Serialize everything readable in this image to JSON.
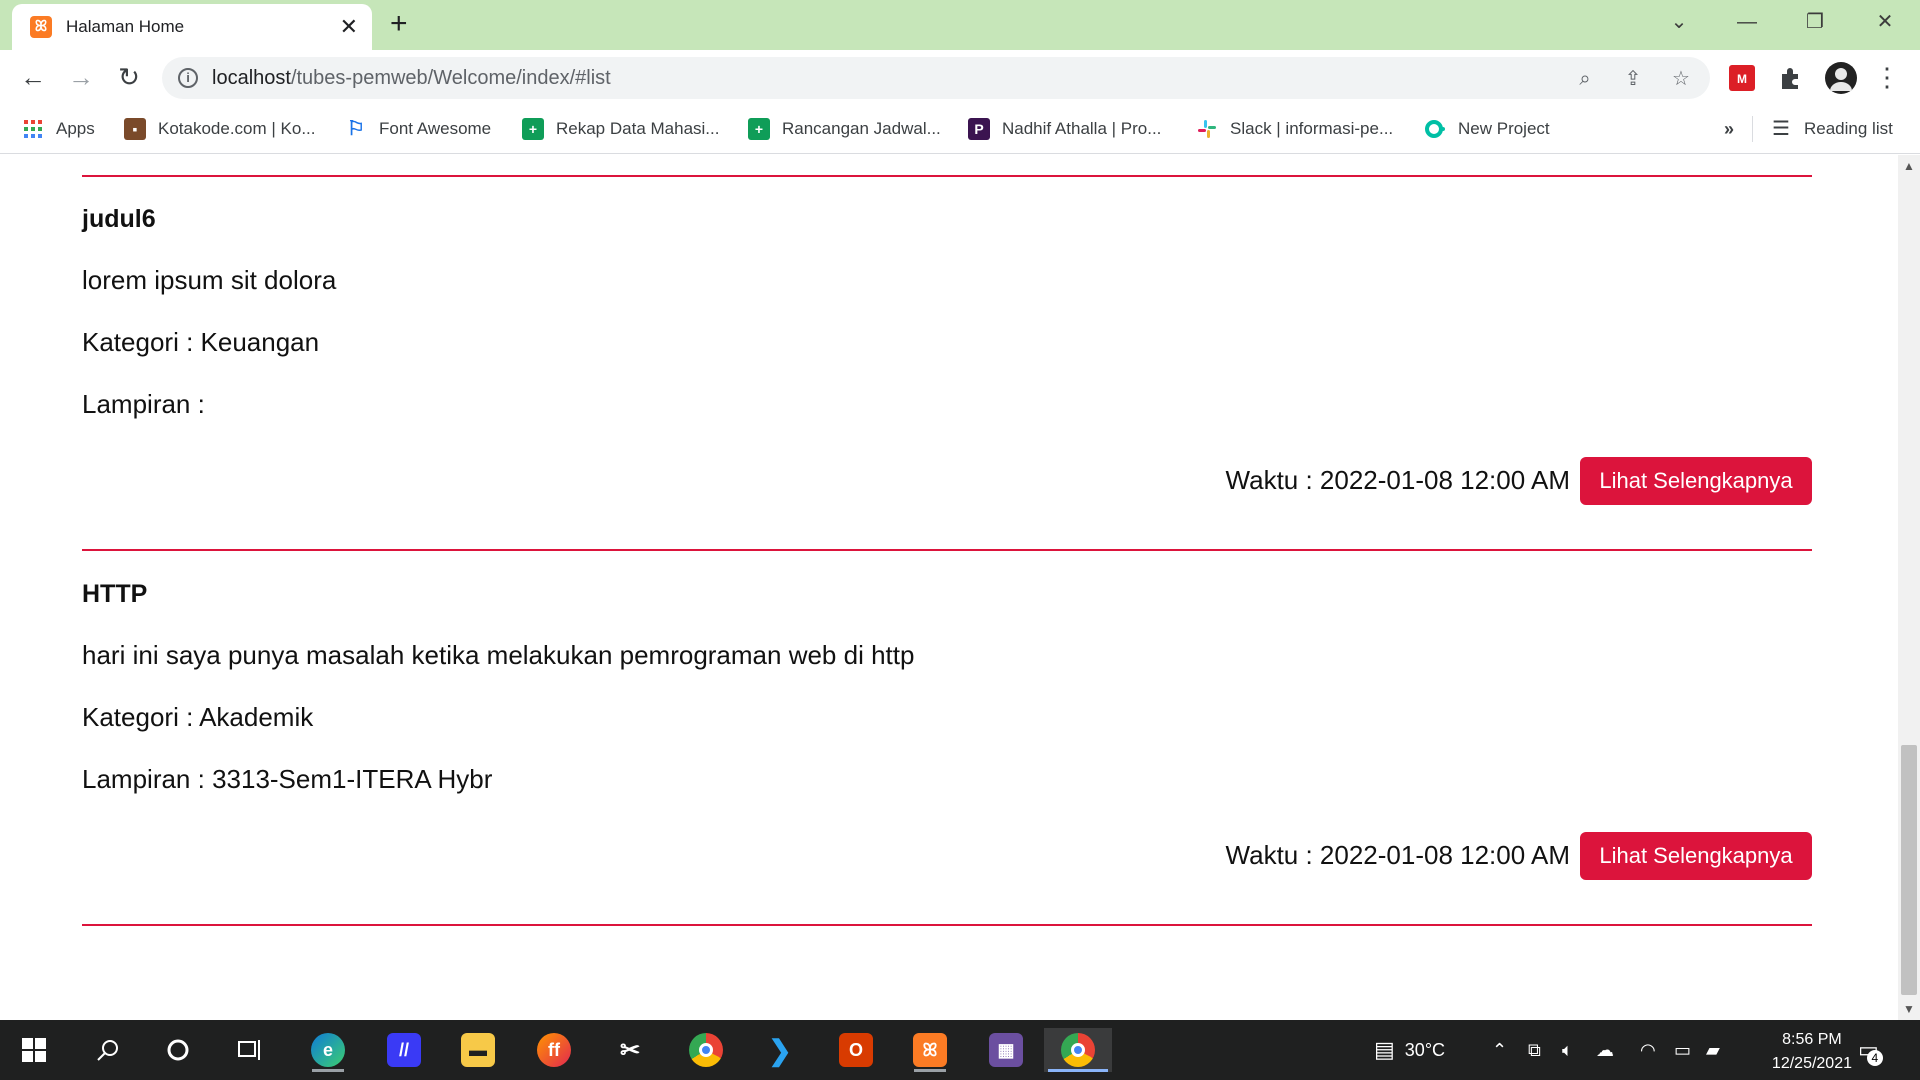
{
  "browser": {
    "tab_title": "Halaman Home",
    "url_host": "localhost",
    "url_path": "/tubes-pemweb/Welcome/index/#list",
    "bookmarks": [
      {
        "label": "Apps",
        "icon": "apps-grid-icon",
        "color": "#ea4335"
      },
      {
        "label": "Kotakode.com | Ko...",
        "icon": "kotakode-icon",
        "color": "#7a4a2a"
      },
      {
        "label": "Font Awesome",
        "icon": "flag-icon",
        "color": "#1a73e8"
      },
      {
        "label": "Rekap Data Mahasi...",
        "icon": "sheets-icon",
        "color": "#0f9d58"
      },
      {
        "label": "Rancangan Jadwal...",
        "icon": "sheets-icon",
        "color": "#0f9d58"
      },
      {
        "label": "Nadhif Athalla | Pro...",
        "icon": "p-icon",
        "color": "#3b1450"
      },
      {
        "label": "Slack | informasi-pe...",
        "icon": "slack-icon",
        "color": "#e01e5a"
      },
      {
        "label": "New Project",
        "icon": "project-icon",
        "color": "#00bfa5"
      }
    ],
    "more_bookmarks": "»",
    "reading_list": "Reading list"
  },
  "posts": [
    {
      "title": "judul6",
      "body": "lorem ipsum sit dolora",
      "category": "Kategori : Keuangan",
      "attachment": "Lampiran :",
      "time": "Waktu : 2022-01-08 12:00 AM",
      "button": "Lihat Selengkapnya"
    },
    {
      "title": "HTTP",
      "body": "hari ini saya punya masalah ketika melakukan pemrograman web di http",
      "category": "Kategori : Akademik",
      "attachment": "Lampiran : 3313-Sem1-ITERA Hybr",
      "time": "Waktu : 2022-01-08 12:00 AM",
      "button": "Lihat Selengkapnya"
    }
  ],
  "colors": {
    "accent": "#dc143c",
    "tabstrip": "#c6e6b9",
    "taskbar": "#1f2020"
  },
  "taskbar": {
    "weather": "30°C",
    "time": "8:56 PM",
    "date": "12/25/2021",
    "notifications": "4"
  }
}
